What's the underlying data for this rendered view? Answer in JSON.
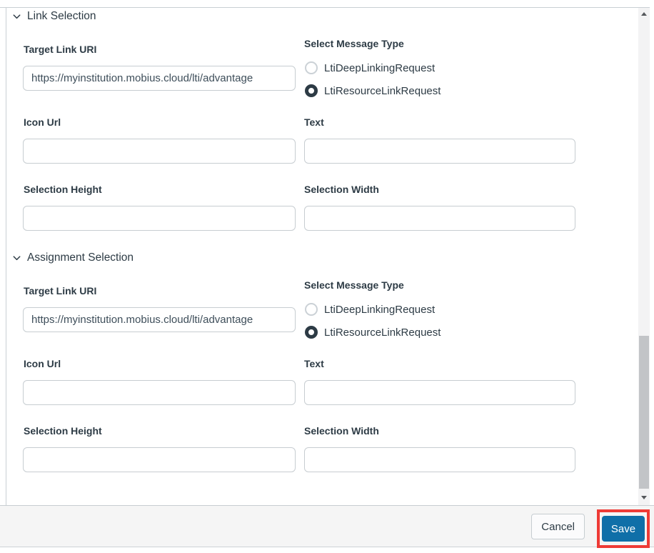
{
  "colors": {
    "ink": "#2D3B45",
    "input_border": "#C7CDD1",
    "save_button_bg": "#0F6FA8",
    "annotation_red": "#EE3B36",
    "footer_bg": "#F5F5F5"
  },
  "sections": [
    {
      "title": "Link Selection",
      "target_link_uri": {
        "label": "Target Link URI",
        "value": "https://myinstitution.mobius.cloud/lti/advantage",
        "placeholder": ""
      },
      "message_type": {
        "label": "Select Message Type",
        "options": [
          {
            "label": "LtiDeepLinkingRequest",
            "selected": false
          },
          {
            "label": "LtiResourceLinkRequest",
            "selected": true
          }
        ]
      },
      "icon_url": {
        "label": "Icon Url",
        "value": "",
        "placeholder": ""
      },
      "text": {
        "label": "Text",
        "value": "",
        "placeholder": ""
      },
      "selection_height": {
        "label": "Selection Height",
        "value": "",
        "placeholder": ""
      },
      "selection_width": {
        "label": "Selection Width",
        "value": "",
        "placeholder": ""
      }
    },
    {
      "title": "Assignment Selection",
      "target_link_uri": {
        "label": "Target Link URI",
        "value": "https://myinstitution.mobius.cloud/lti/advantage",
        "placeholder": ""
      },
      "message_type": {
        "label": "Select Message Type",
        "options": [
          {
            "label": "LtiDeepLinkingRequest",
            "selected": false
          },
          {
            "label": "LtiResourceLinkRequest",
            "selected": true
          }
        ]
      },
      "icon_url": {
        "label": "Icon Url",
        "value": "",
        "placeholder": ""
      },
      "text": {
        "label": "Text",
        "value": "",
        "placeholder": ""
      },
      "selection_height": {
        "label": "Selection Height",
        "value": "",
        "placeholder": ""
      },
      "selection_width": {
        "label": "Selection Width",
        "value": "",
        "placeholder": ""
      }
    }
  ],
  "footer": {
    "cancel_label": "Cancel",
    "save_label": "Save"
  }
}
